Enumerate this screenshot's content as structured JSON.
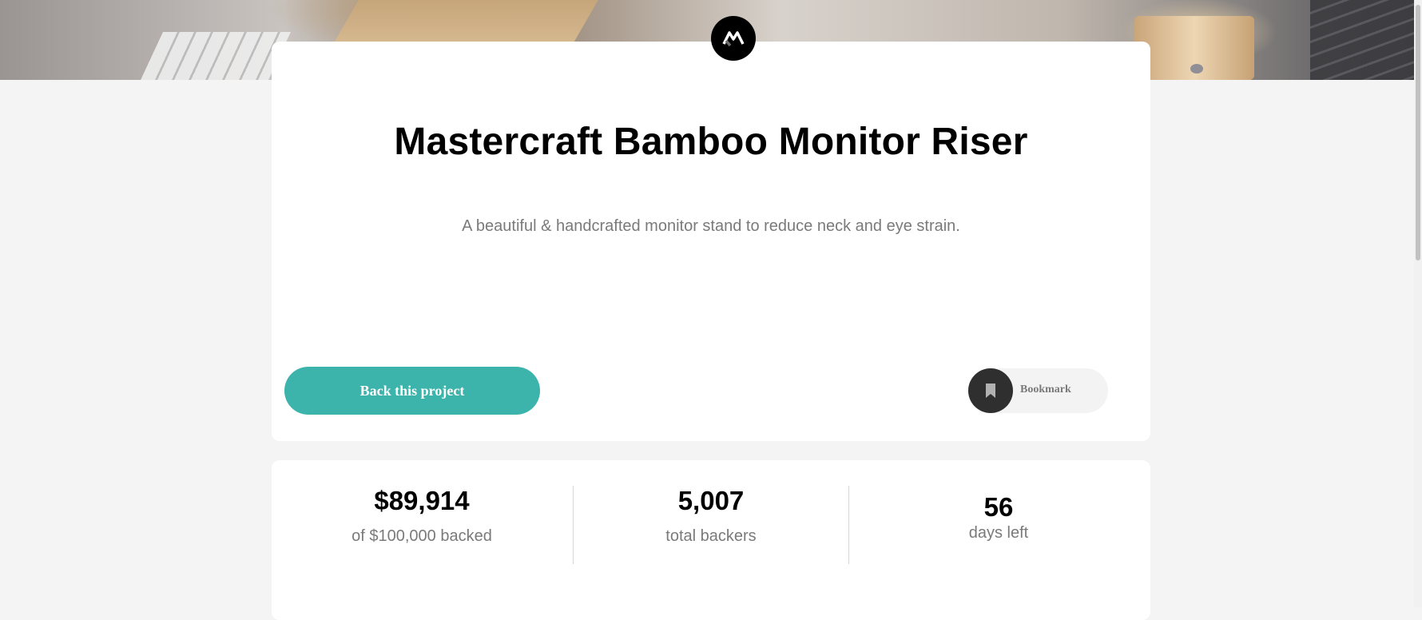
{
  "project": {
    "title": "Mastercraft Bamboo Monitor Riser",
    "description": "A beautiful & handcrafted monitor stand to reduce neck and eye strain."
  },
  "actions": {
    "back_label": "Back this project",
    "bookmark_label": "Bookmark"
  },
  "stats": {
    "backed_amount": "$89,914",
    "backed_label": "of $100,000 backed",
    "backers_count": "5,007",
    "backers_label": "total backers",
    "days_count": "56",
    "days_label": "days left"
  },
  "icons": {
    "logo": "mastercraft-logo-icon",
    "bookmark": "bookmark-icon"
  },
  "colors": {
    "accent": "#3cb4ac",
    "dark": "#2f2f2f",
    "background": "#f4f4f4"
  }
}
